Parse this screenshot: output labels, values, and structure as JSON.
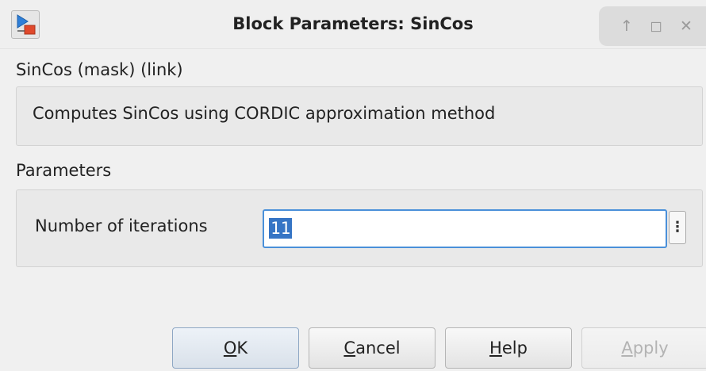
{
  "window": {
    "title": "Block Parameters: SinCos",
    "controls": {
      "up_icon": "arrow-up-icon",
      "maximize_icon": "maximize-icon",
      "close_icon": "close-icon"
    }
  },
  "mask": {
    "header": "SinCos (mask) (link)",
    "description": "Computes SinCos using CORDIC approximation method"
  },
  "parameters": {
    "header": "Parameters",
    "fields": [
      {
        "label": "Number of iterations",
        "value": "11"
      }
    ],
    "menu_glyph": "⋮"
  },
  "buttons": {
    "ok": {
      "label": "OK",
      "mnemonic": "O",
      "rest": "K"
    },
    "cancel": {
      "label": "Cancel",
      "mnemonic": "C",
      "rest": "ancel"
    },
    "help": {
      "label": "Help",
      "mnemonic": "H",
      "rest": "elp"
    },
    "apply": {
      "label": "Apply",
      "mnemonic": "A",
      "rest": "pply",
      "enabled": false
    }
  },
  "colors": {
    "selection": "#3675c5",
    "focus_border": "#4a90d9",
    "disabled_text": "#b3b3b3"
  }
}
